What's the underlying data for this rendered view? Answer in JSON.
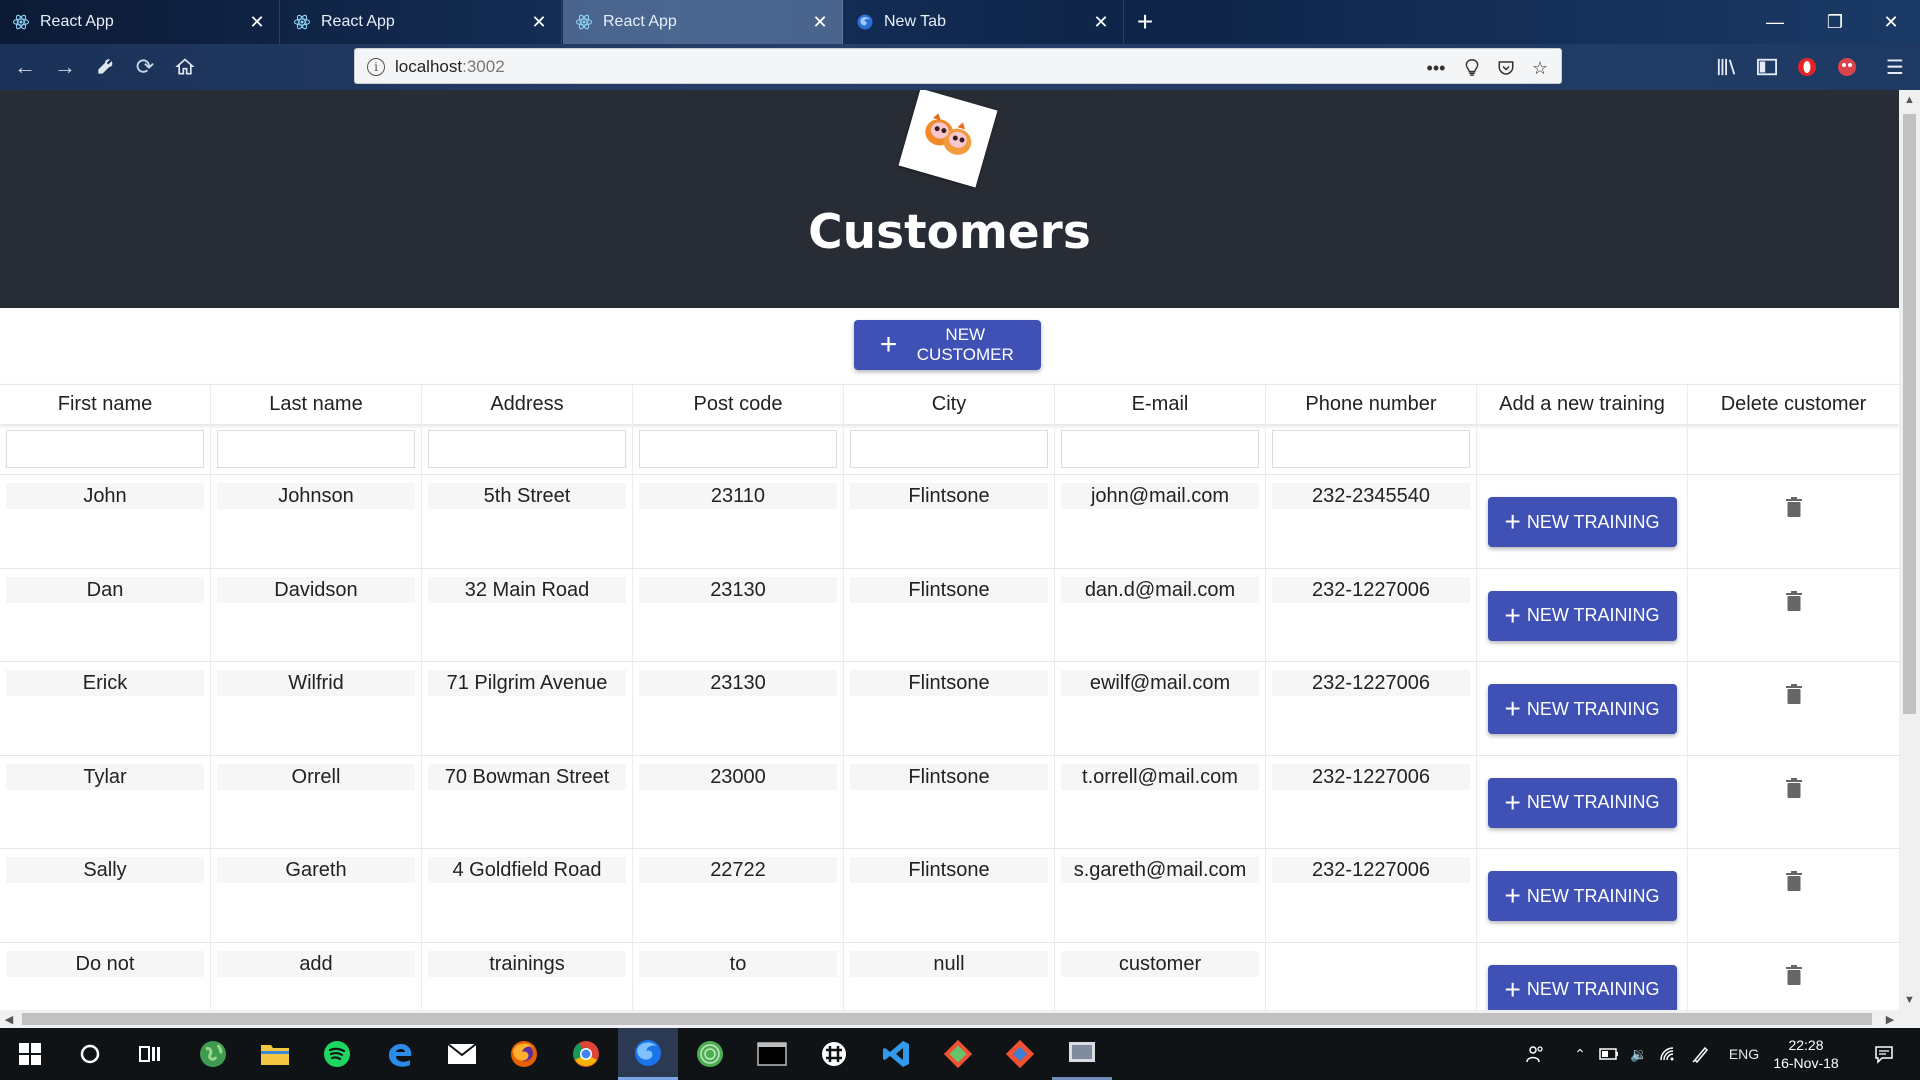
{
  "browser": {
    "tabs": [
      {
        "title": "React App",
        "active": false
      },
      {
        "title": "React App",
        "active": false
      },
      {
        "title": "React App",
        "active": true
      },
      {
        "title": "New Tab",
        "active": false
      }
    ],
    "url_host": "localhost",
    "url_port": ":3002"
  },
  "header": {
    "title": "Customers"
  },
  "new_customer_button": {
    "label": "NEW CUSTOMER"
  },
  "table": {
    "columns": [
      "First name",
      "Last name",
      "Address",
      "Post code",
      "City",
      "E-mail",
      "Phone number",
      "Add a new training",
      "Delete customer"
    ],
    "rows": [
      {
        "first": "John",
        "last": "Johnson",
        "address": "5th Street",
        "postcode": "23110",
        "city": "Flintsone",
        "email": "john@mail.com",
        "phone": "232-2345540"
      },
      {
        "first": "Dan",
        "last": "Davidson",
        "address": "32 Main Road",
        "postcode": "23130",
        "city": "Flintsone",
        "email": "dan.d@mail.com",
        "phone": "232-1227006"
      },
      {
        "first": "Erick",
        "last": "Wilfrid",
        "address": "71 Pilgrim Avenue",
        "postcode": "23130",
        "city": "Flintsone",
        "email": "ewilf@mail.com",
        "phone": "232-1227006"
      },
      {
        "first": "Tylar",
        "last": "Orrell",
        "address": "70 Bowman Street",
        "postcode": "23000",
        "city": "Flintsone",
        "email": "t.orrell@mail.com",
        "phone": "232-1227006"
      },
      {
        "first": "Sally",
        "last": "Gareth",
        "address": "4 Goldfield Road",
        "postcode": "22722",
        "city": "Flintsone",
        "email": "s.gareth@mail.com",
        "phone": "232-1227006"
      },
      {
        "first": "Do not",
        "last": "add",
        "address": "trainings",
        "postcode": "to",
        "city": "null",
        "email": "customer",
        "phone": ""
      }
    ],
    "training_button_label": "NEW TRAINING"
  },
  "taskbar": {
    "language": "ENG",
    "time": "22:28",
    "date": "16-Nov-18"
  },
  "colors": {
    "header_bg": "#282c34",
    "primary_button": "#3f51b5"
  }
}
